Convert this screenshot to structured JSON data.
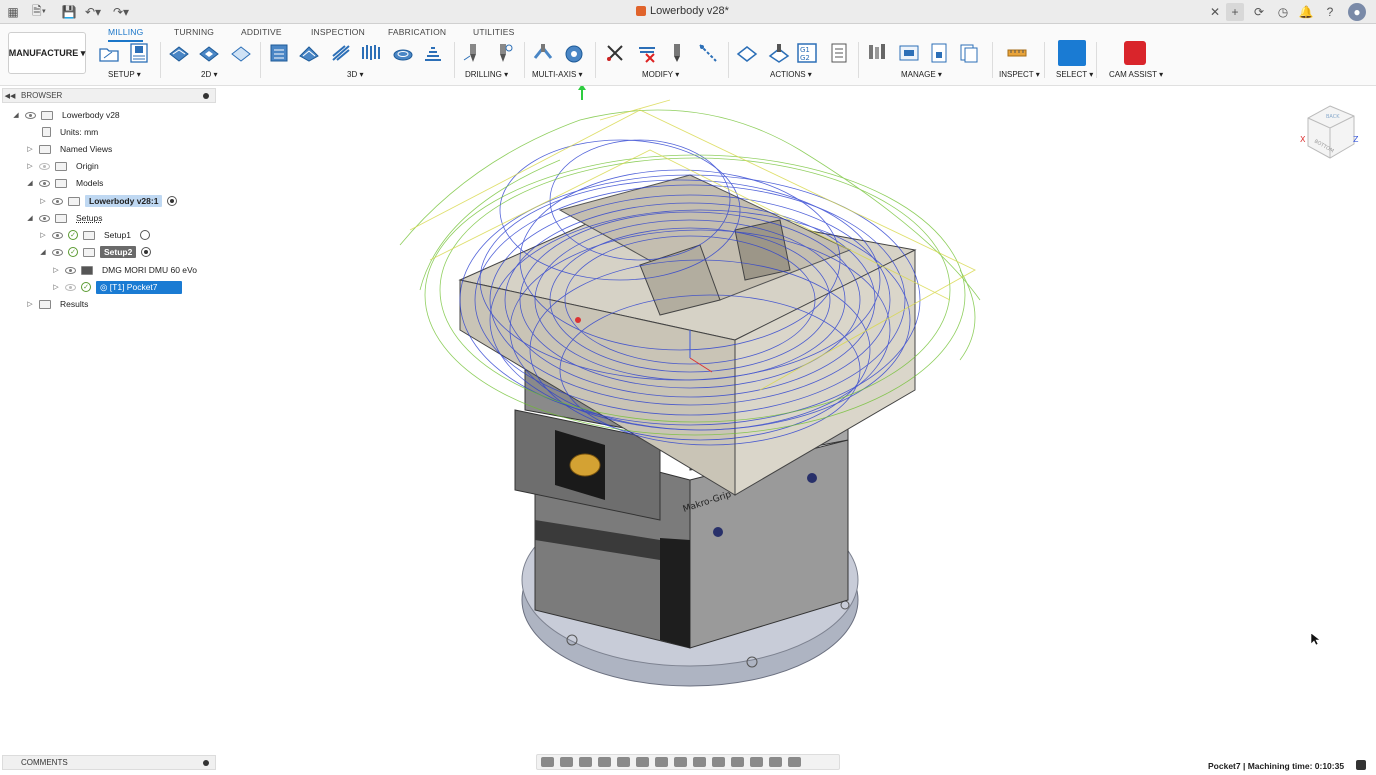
{
  "titlebar": {
    "doc_title": "Lowerbody v28*"
  },
  "toolbar": {
    "workspace": "MANUFACTURE",
    "tabs": [
      "MILLING",
      "TURNING",
      "ADDITIVE",
      "INSPECTION",
      "FABRICATION",
      "UTILITIES"
    ],
    "groups": [
      "SETUP",
      "2D",
      "3D",
      "DRILLING",
      "MULTI-AXIS",
      "MODIFY",
      "ACTIONS",
      "MANAGE",
      "INSPECT",
      "SELECT",
      "CAM ASSIST"
    ]
  },
  "browser": {
    "title": "BROWSER",
    "items": [
      {
        "label": "Lowerbody v28"
      },
      {
        "label": "Units: mm"
      },
      {
        "label": "Named Views"
      },
      {
        "label": "Origin"
      },
      {
        "label": "Models"
      },
      {
        "label": "Lowerbody v28:1"
      },
      {
        "label": "Setups"
      },
      {
        "label": "Setup1"
      },
      {
        "label": "Setup2"
      },
      {
        "label": "DMG MORI DMU 60 eVo"
      },
      {
        "label": "[T1] Pocket7"
      },
      {
        "label": "Results"
      }
    ]
  },
  "viewcube": {
    "x_label": "X",
    "z_label": "Z",
    "top_label": "BACK",
    "front_label": "BOTTOM"
  },
  "model": {
    "vise_brand": "Makro-Grip"
  },
  "comments": {
    "label": "COMMENTS"
  },
  "status": {
    "text": "Pocket7 | Machining time: 0:10:35"
  },
  "colors": {
    "accent": "#1a76c9",
    "toolpath_blue": "#2a3fd0",
    "toolpath_green": "#6bbf2a",
    "toolpath_yellow": "#d8d84a",
    "cam_assist": "#d9252b"
  }
}
